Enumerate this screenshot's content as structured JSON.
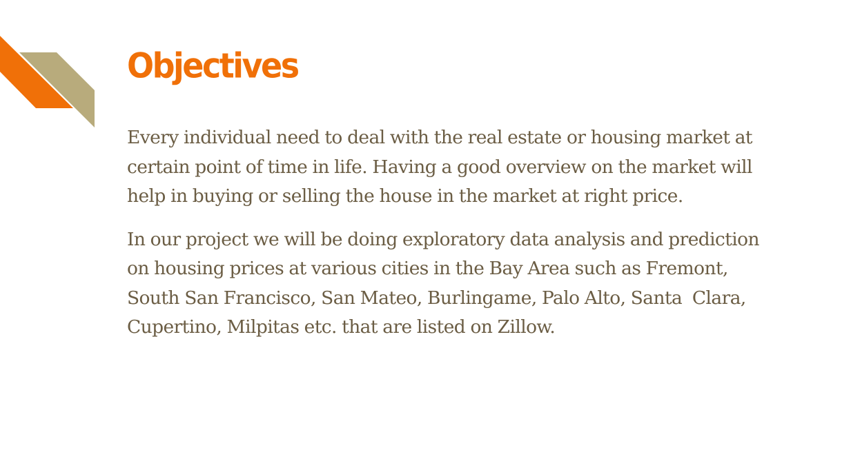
{
  "slide": {
    "title": "Objectives",
    "paragraphs": [
      "Every individual need to deal with the real estate or housing market at certain point of time in life. Having a good overview on the market will help in buying or selling the house in the market at right price.",
      "In our project we will be doing exploratory data analysis and prediction on housing prices at various cities in the Bay Area such as Fremont, South San Francisco, San Mateo, Burlingame, Palo Alto, Santa  Clara, Cupertino, Milpitas etc. that are listed on Zillow."
    ]
  },
  "colors": {
    "accent_orange": "#f07008",
    "accent_tan": "#b8ab7c",
    "body_text": "#6b5d44",
    "background": "#ffffff"
  }
}
